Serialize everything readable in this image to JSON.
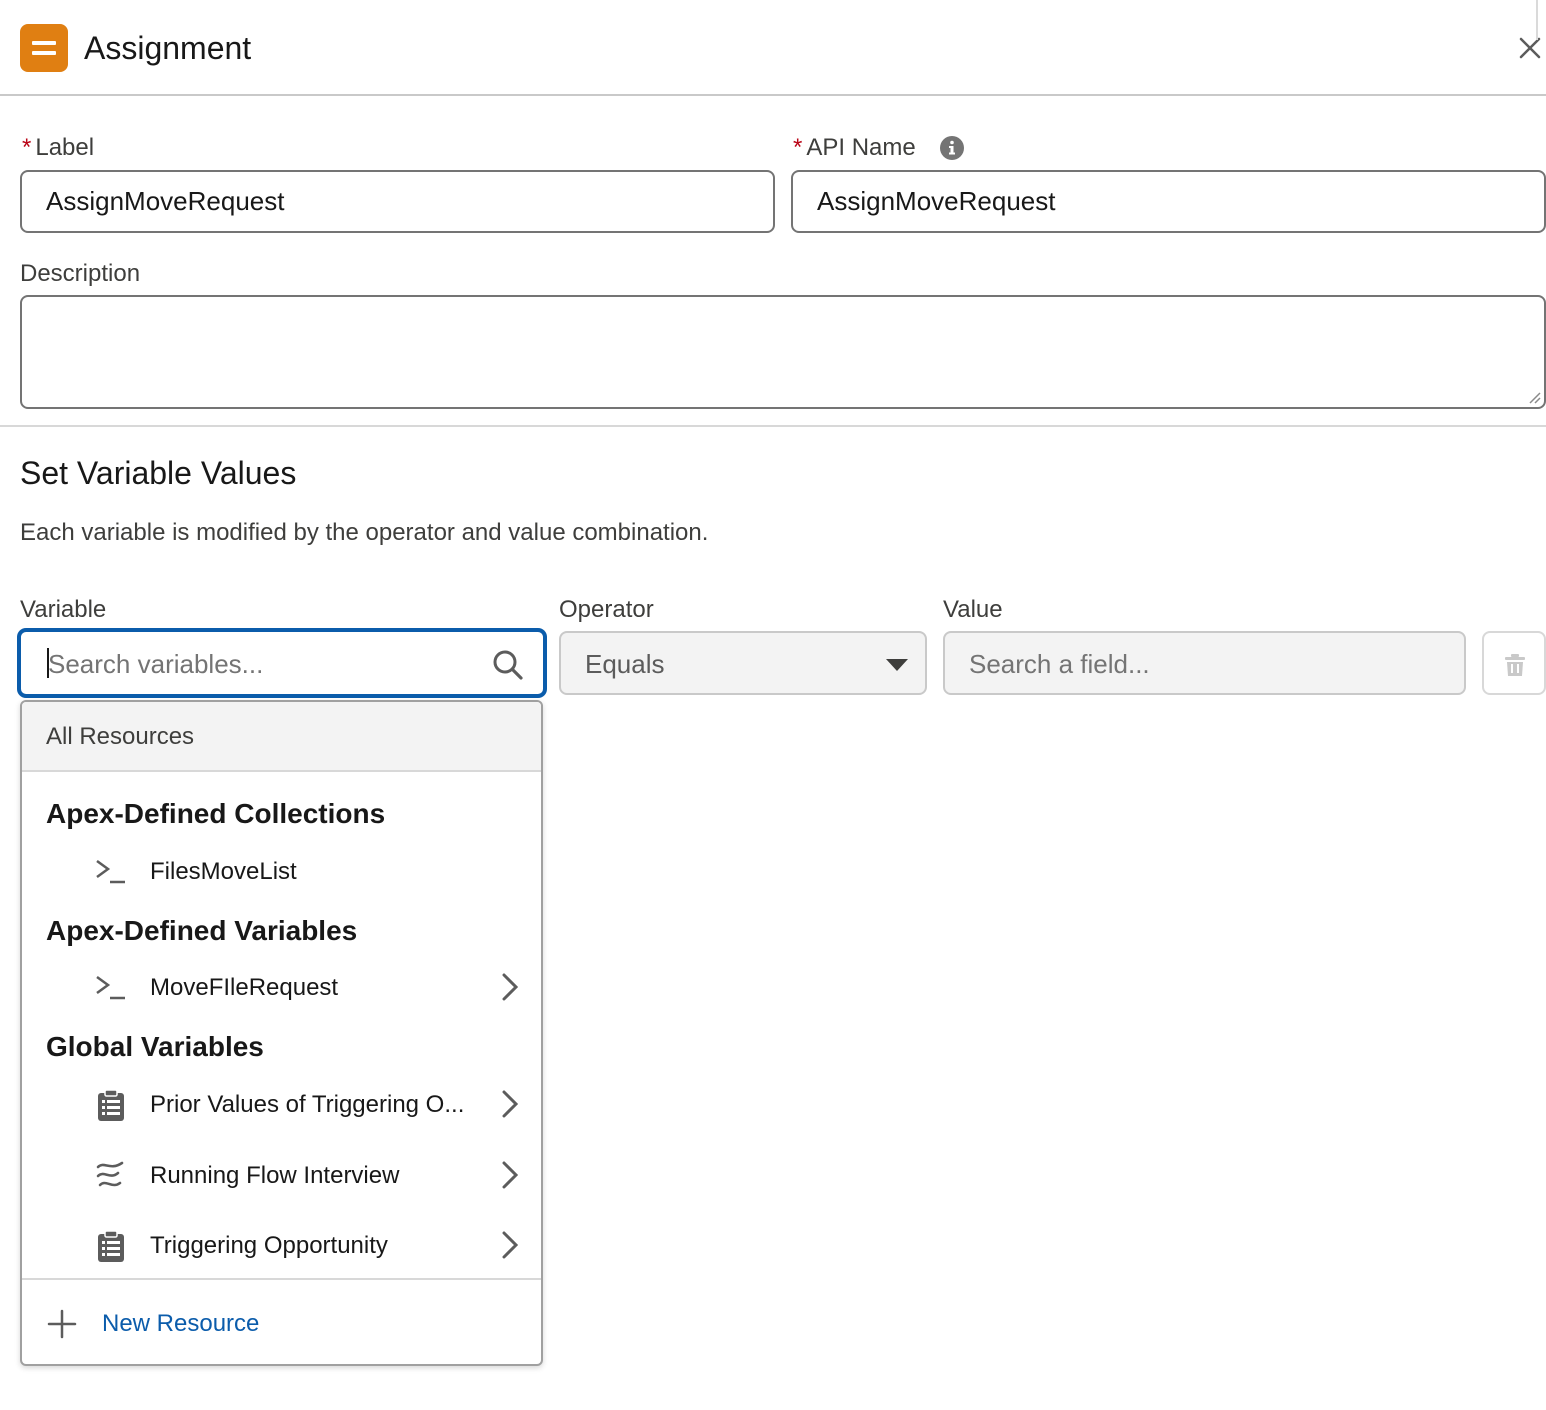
{
  "header": {
    "title": "Assignment",
    "close_icon": "close-icon",
    "app_icon": "assignment-icon"
  },
  "form": {
    "label": {
      "label": "Label",
      "required_marker": "*",
      "value": "AssignMoveRequest"
    },
    "api_name": {
      "label": "API Name",
      "required_marker": "*",
      "value": "AssignMoveRequest",
      "info_icon": "info-icon"
    },
    "description": {
      "label": "Description",
      "value": ""
    }
  },
  "section": {
    "title": "Set Variable Values",
    "description": "Each variable is modified by the operator and value combination."
  },
  "assignment_row": {
    "variable_label": "Variable",
    "variable_placeholder": "Search variables...",
    "operator_label": "Operator",
    "operator_value": "Equals",
    "value_label": "Value",
    "value_placeholder": "Search a field..."
  },
  "dropdown": {
    "header": "All Resources",
    "groups": [
      {
        "title": "Apex-Defined Collections",
        "items": [
          {
            "label": "FilesMoveList",
            "icon": "apex-icon",
            "has_submenu": false
          }
        ]
      },
      {
        "title": "Apex-Defined Variables",
        "items": [
          {
            "label": "MoveFIleRequest",
            "icon": "apex-icon",
            "has_submenu": true
          }
        ]
      },
      {
        "title": "Global Variables",
        "items": [
          {
            "label": "Prior Values of Triggering O...",
            "icon": "record-icon",
            "has_submenu": true
          },
          {
            "label": "Running Flow Interview",
            "icon": "flow-icon",
            "has_submenu": true
          },
          {
            "label": "Triggering Opportunity",
            "icon": "record-icon",
            "has_submenu": true
          }
        ]
      }
    ],
    "footer": {
      "label": "New Resource",
      "icon": "add-icon"
    }
  },
  "colors": {
    "brand_orange": "#e07f12",
    "focus_blue": "#0b5cab",
    "required_red": "#ba0517"
  }
}
